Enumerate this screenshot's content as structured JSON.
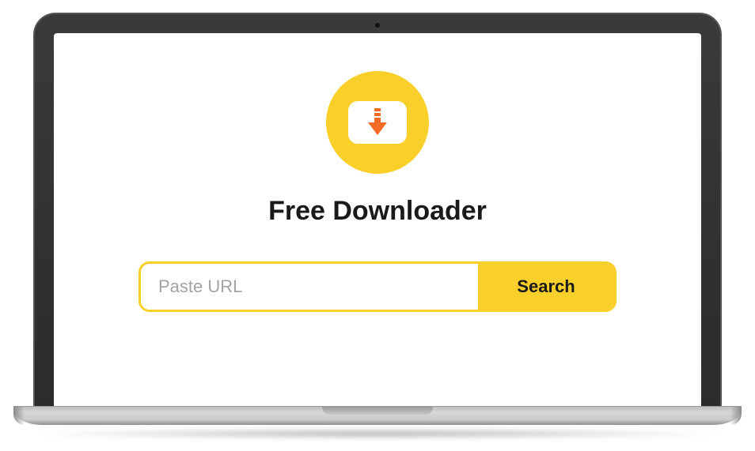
{
  "app": {
    "title": "Free Downloader"
  },
  "search": {
    "placeholder": "Paste URL",
    "value": "",
    "button_label": "Search"
  },
  "colors": {
    "accent": "#F9CF2A",
    "icon_arrow": "#F26B24"
  },
  "icons": {
    "logo": "download-arrow-icon"
  }
}
